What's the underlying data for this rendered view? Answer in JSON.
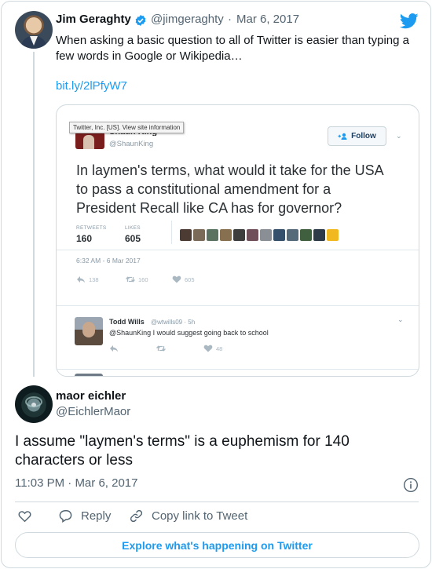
{
  "parent_tweet": {
    "author_name": "Jim Geraghty",
    "author_handle": "@jimgeraghty",
    "separator": "·",
    "date": "Mar 6, 2017",
    "text_line1": "When asking a basic question to all of Twitter is easier than typing a",
    "text_line2": "few words in Google or Wikipedia…",
    "link": "bit.ly/2lPfyW7",
    "avatar_icon": "person-avatar",
    "verified_icon": "verified-badge-icon",
    "brand_icon": "twitter-bird-icon",
    "accent_color": "#1d9bf0"
  },
  "embedded_screenshot": {
    "tooltip": "Twitter, Inc. [US]. View site information",
    "author_name": "Shaun King",
    "author_handle": "@ShaunKing",
    "follow_label": "Follow",
    "text_line1": "In laymen's terms, what would it take for the USA",
    "text_line2": "to pass a constitutional amendment for a",
    "text_line3": "President Recall like CA has for governor?",
    "retweets_label": "RETWEETS",
    "retweets_value": "160",
    "likes_label": "LIKES",
    "likes_value": "605",
    "time": "6:32 AM - 6 Mar 2017",
    "reply_count": "138",
    "retweet_count": "160",
    "like_count": "605",
    "mini_avatar_colors": [
      "#4b3b33",
      "#7a6a58",
      "#5c7260",
      "#86704f",
      "#3d3d3d",
      "#6e4f5a",
      "#8a8f96",
      "#35506a",
      "#566b7a",
      "#3f5f3f",
      "#2e3a48",
      "#f2b81f"
    ],
    "reply": {
      "author_name": "Todd Wills",
      "author_handle": "@wtwills09 · 5h",
      "text": "@ShaunKing I would suggest going back to school",
      "like_count": "48"
    }
  },
  "main_tweet": {
    "author_name": "maor eichler",
    "author_handle": "@EichlerMaor",
    "text_line1": "I assume \"laymen's terms\" is a euphemism for 140",
    "text_line2": "characters or less",
    "time": "11:03 PM",
    "separator": "·",
    "date": "Mar 6, 2017",
    "info_icon": "info-icon"
  },
  "actions": {
    "like_icon": "heart-icon",
    "reply_label": "Reply",
    "copy_label": "Copy link to Tweet",
    "explore_label": "Explore what's happening on Twitter"
  }
}
